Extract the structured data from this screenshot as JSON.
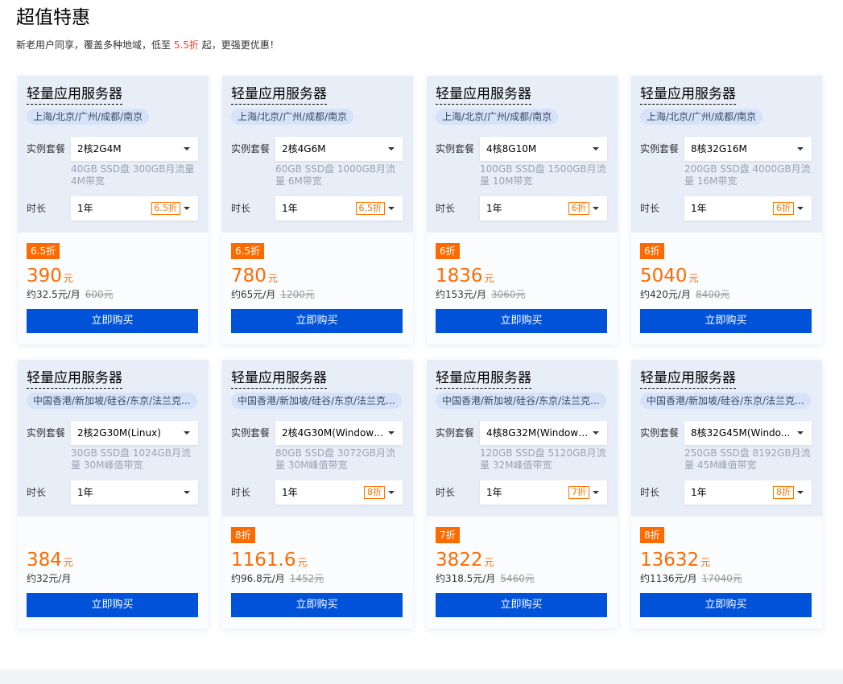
{
  "header": {
    "title": "超值特惠",
    "subtitle_before": "新老用户同享，覆盖多种地域，低至 ",
    "subtitle_highlight": "5.5折",
    "subtitle_after": " 起，更强更优惠！"
  },
  "labels": {
    "spec": "实例套餐",
    "duration": "时长",
    "buy": "立即购买"
  },
  "colors": {
    "accent_orange": "#ff6a00",
    "buy_blue": "#0052d9",
    "card_top_bg": "#e8eef8",
    "highlight_red": "#ff3f2e"
  },
  "cards": [
    {
      "title": "轻量应用服务器",
      "region": "上海/北京/广州/成都/南京",
      "spec": "2核2G4M",
      "desc": "40GB SSD盘 300GB月流量 4M带宽",
      "duration": "1年",
      "discount_tag": "6.5折",
      "badge": "6.5折",
      "price": "390",
      "unit": "元",
      "monthly": "约32.5元/月",
      "original": "600元"
    },
    {
      "title": "轻量应用服务器",
      "region": "上海/北京/广州/成都/南京",
      "spec": "2核4G6M",
      "desc": "60GB SSD盘 1000GB月流量 6M带宽",
      "duration": "1年",
      "discount_tag": "6.5折",
      "badge": "6.5折",
      "price": "780",
      "unit": "元",
      "monthly": "约65元/月",
      "original": "1200元"
    },
    {
      "title": "轻量应用服务器",
      "region": "上海/北京/广州/成都/南京",
      "spec": "4核8G10M",
      "desc": "100GB SSD盘 1500GB月流量 10M带宽",
      "duration": "1年",
      "discount_tag": "6折",
      "badge": "6折",
      "price": "1836",
      "unit": "元",
      "monthly": "约153元/月",
      "original": "3060元"
    },
    {
      "title": "轻量应用服务器",
      "region": "上海/北京/广州/成都/南京",
      "spec": "8核32G16M",
      "desc": "200GB SSD盘 4000GB月流量 16M带宽",
      "duration": "1年",
      "discount_tag": "6折",
      "badge": "6折",
      "price": "5040",
      "unit": "元",
      "monthly": "约420元/月",
      "original": "8400元"
    },
    {
      "title": "轻量应用服务器",
      "region": "中国香港/新加坡/硅谷/东京/法兰克...",
      "spec": "2核2G30M(Linux)",
      "desc": "30GB SSD盘 1024GB月流量 30M峰值带宽",
      "duration": "1年",
      "discount_tag": "",
      "badge": "",
      "price": "384",
      "unit": "元",
      "monthly": "约32元/月",
      "original": ""
    },
    {
      "title": "轻量应用服务器",
      "region": "中国香港/新加坡/硅谷/东京/法兰克...",
      "spec": "2核4G30M(Windows...",
      "desc": "80GB SSD盘 3072GB月流量 30M峰值带宽",
      "duration": "1年",
      "discount_tag": "8折",
      "badge": "8折",
      "price": "1161.6",
      "unit": "元",
      "monthly": "约96.8元/月",
      "original": "1452元"
    },
    {
      "title": "轻量应用服务器",
      "region": "中国香港/新加坡/硅谷/东京/法兰克...",
      "spec": "4核8G32M(Windows...",
      "desc": "120GB SSD盘 5120GB月流量 32M峰值带宽",
      "duration": "1年",
      "discount_tag": "7折",
      "badge": "7折",
      "price": "3822",
      "unit": "元",
      "monthly": "约318.5元/月",
      "original": "5460元"
    },
    {
      "title": "轻量应用服务器",
      "region": "中国香港/新加坡/硅谷/东京/法兰克...",
      "spec": "8核32G45M(Windo...",
      "desc": "250GB SSD盘 8192GB月流量 45M峰值带宽",
      "duration": "1年",
      "discount_tag": "8折",
      "badge": "8折",
      "price": "13632",
      "unit": "元",
      "monthly": "约1136元/月",
      "original": "17040元"
    }
  ]
}
